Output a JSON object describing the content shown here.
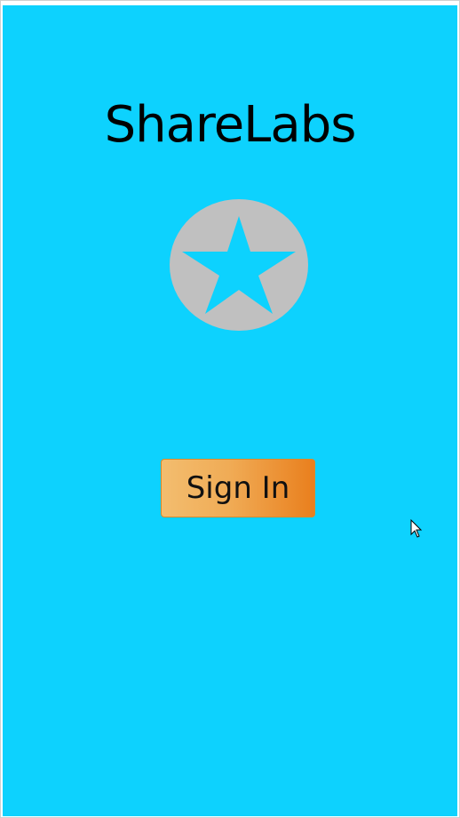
{
  "app": {
    "title": "ShareLabs"
  },
  "logo": {
    "icon": "star-icon",
    "circle_color": "#c0c0c0",
    "star_color": "#0dd2fe"
  },
  "actions": {
    "sign_in_label": "Sign In"
  },
  "colors": {
    "background": "#0dd2fe",
    "button_gradient_start": "#f3bd6f",
    "button_gradient_end": "#e97f1d",
    "text": "#000000"
  }
}
